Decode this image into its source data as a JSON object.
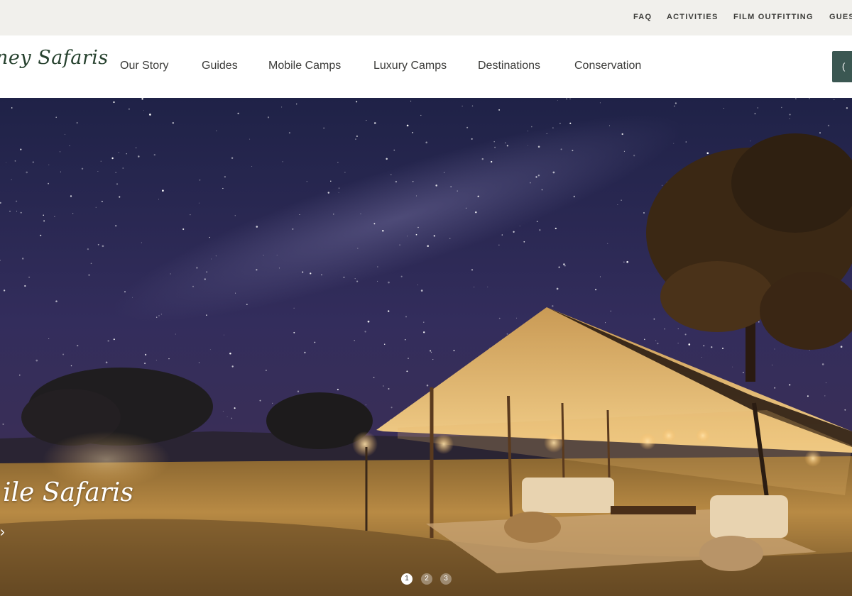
{
  "utility_nav": {
    "items": [
      "FAQ",
      "ACTIVITIES",
      "FILM OUTFITTING",
      "GUES"
    ]
  },
  "header": {
    "logo_text": "ney Safaris",
    "nav_items": [
      "Our Story",
      "Guides",
      "Mobile Camps",
      "Luxury Camps",
      "Destinations",
      "Conservation"
    ],
    "cta_label": "("
  },
  "hero": {
    "title": "ile Safaris",
    "arrow": "›",
    "slides": [
      "1",
      "2",
      "3"
    ],
    "active_slide": 1
  },
  "colors": {
    "utility_bg": "#f1f0ec",
    "brand_green": "#27422f",
    "cta_bg": "#3b5752",
    "sky": "#2e2b57",
    "tent_glow": "#f1c27a"
  }
}
